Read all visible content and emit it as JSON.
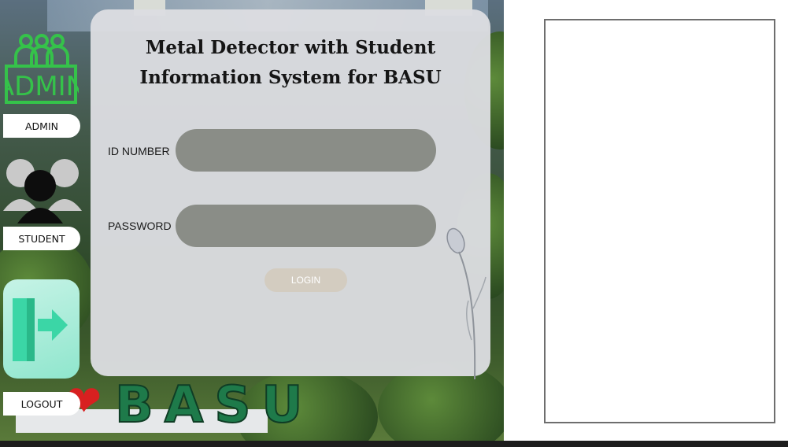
{
  "title": "Metal Detector with Student Information System for BASU",
  "sidebar": {
    "admin_icon_text": "ADMIN",
    "admin_label": "ADMIN",
    "student_label": "STUDENT",
    "logout_label": "LOGOUT"
  },
  "form": {
    "id_label": "ID NUMBER",
    "password_label": "PASSWORD",
    "id_value": "",
    "password_value": "",
    "login_label": "LOGIN"
  },
  "background": {
    "basu_text": "BASU"
  },
  "colors": {
    "admin_green": "#35c24a",
    "field_gray": "#8a8d87",
    "logout_tile": "#a5ecd6",
    "logout_icon": "#3bd6a6"
  }
}
